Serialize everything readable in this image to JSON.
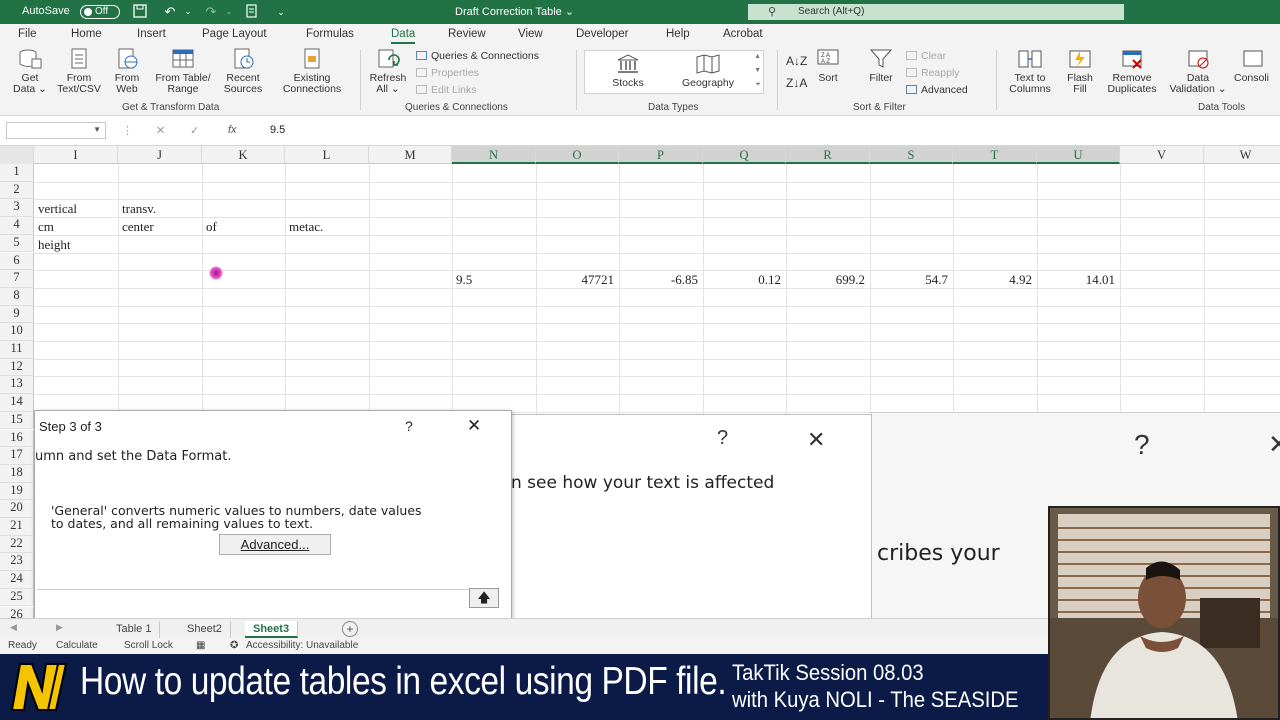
{
  "window": {
    "autosave_label": "AutoSave",
    "autosave_state": "Off",
    "doc_title": "Draft Correction Table",
    "search_placeholder": "Search (Alt+Q)"
  },
  "menu_tabs": [
    "File",
    "Home",
    "Insert",
    "Page Layout",
    "Formulas",
    "Data",
    "Review",
    "View",
    "Developer",
    "Help",
    "Acrobat"
  ],
  "active_tab": "Data",
  "ribbon": {
    "get_data": "Get",
    "get_data_2": "Data",
    "from_text": "From",
    "from_text_2": "Text/CSV",
    "from_web": "From",
    "from_web_2": "Web",
    "from_table": "From Table/",
    "from_table_2": "Range",
    "recent_sources": "Recent",
    "recent_sources_2": "Sources",
    "existing_conn": "Existing",
    "existing_conn_2": "Connections",
    "group_get_transform": "Get & Transform Data",
    "refresh_all": "Refresh",
    "refresh_all_2": "All",
    "queries_connections": "Queries & Connections",
    "properties": "Properties",
    "edit_links": "Edit Links",
    "group_queries": "Queries & Connections",
    "stocks": "Stocks",
    "geography": "Geography",
    "group_data_types": "Data Types",
    "sort": "Sort",
    "filter": "Filter",
    "clear": "Clear",
    "reapply": "Reapply",
    "advanced": "Advanced",
    "group_sort_filter": "Sort & Filter",
    "text_to_columns": "Text to",
    "text_to_columns_2": "Columns",
    "flash_fill": "Flash",
    "flash_fill_2": "Fill",
    "remove_duplicates": "Remove",
    "remove_duplicates_2": "Duplicates",
    "data_validation": "Data",
    "data_validation_2": "Validation",
    "consolidate": "Consoli",
    "group_data_tools": "Data Tools"
  },
  "formula_bar": {
    "value": "9.5"
  },
  "columns": [
    "I",
    "J",
    "K",
    "L",
    "M",
    "N",
    "O",
    "P",
    "Q",
    "R",
    "S",
    "T",
    "U",
    "V",
    "W"
  ],
  "rows": [
    "1",
    "2",
    "3",
    "4",
    "5",
    "6",
    "7",
    "8",
    "9",
    "10",
    "11",
    "12",
    "13",
    "14",
    "15",
    "16",
    "17",
    "18",
    "19",
    "20",
    "21",
    "22",
    "23",
    "24",
    "25",
    "26"
  ],
  "cells": {
    "I3": "vertical",
    "J3": "transv.",
    "I4": "cm",
    "J4": "center",
    "K4": "of",
    "L4": "metac.",
    "I5": "height",
    "N7": "9.5",
    "O7": "47721",
    "P7": "-6.85",
    "Q7": "0.12",
    "R7": "699.2",
    "S7": "54.7",
    "T7": "4.92",
    "U7": "14.01"
  },
  "dialog": {
    "title": "Step 3 of 3",
    "help": "?",
    "close": "✕",
    "instruction": "umn and set the Data Format.",
    "general_note_1": "'General' converts numeric values to numbers, date values",
    "general_note_2": "to dates, and all remaining values to text.",
    "advanced_button": "Advanced...",
    "upload": "🡅"
  },
  "dialog_behind": {
    "help": "?",
    "close": "✕",
    "text_1": "n see how your text is affected",
    "text_2": "cribes your"
  },
  "dialog_back": {
    "help": "?",
    "close": "✕"
  },
  "sheet_tabs": [
    "Table 1",
    "Sheet2",
    "Sheet3"
  ],
  "active_sheet": "Sheet3",
  "status_bar": {
    "ready": "Ready",
    "calculate": "Calculate",
    "scroll_lock": "Scroll Lock",
    "accessibility": "Accessibility: Unavailable"
  },
  "banner": {
    "title": "How to update tables in excel using PDF file.",
    "session": "TakTik Session 08.03",
    "host": "with Kuya NOLI - The SEASIDE"
  },
  "colors": {
    "excel_green": "#217346",
    "banner_blue": "#0b1a47",
    "logo_yellow": "#f5c400"
  }
}
